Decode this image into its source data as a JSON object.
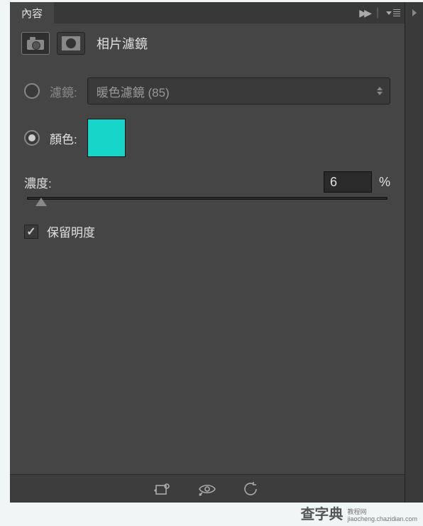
{
  "tab": {
    "title": "內容"
  },
  "header": {
    "title": "相片濾鏡"
  },
  "filter": {
    "radio_label": "濾鏡:",
    "selected": "暖色濾鏡 (85)"
  },
  "color": {
    "radio_label": "顏色:",
    "swatch_hex": "#17d6c9"
  },
  "density": {
    "label": "濃度:",
    "value": "6",
    "unit": "%"
  },
  "preserve": {
    "label": "保留明度",
    "checked": true
  },
  "watermark": {
    "main": "查字典",
    "sub1": "教程网",
    "sub2": "jiaocheng.chazidian.com"
  }
}
